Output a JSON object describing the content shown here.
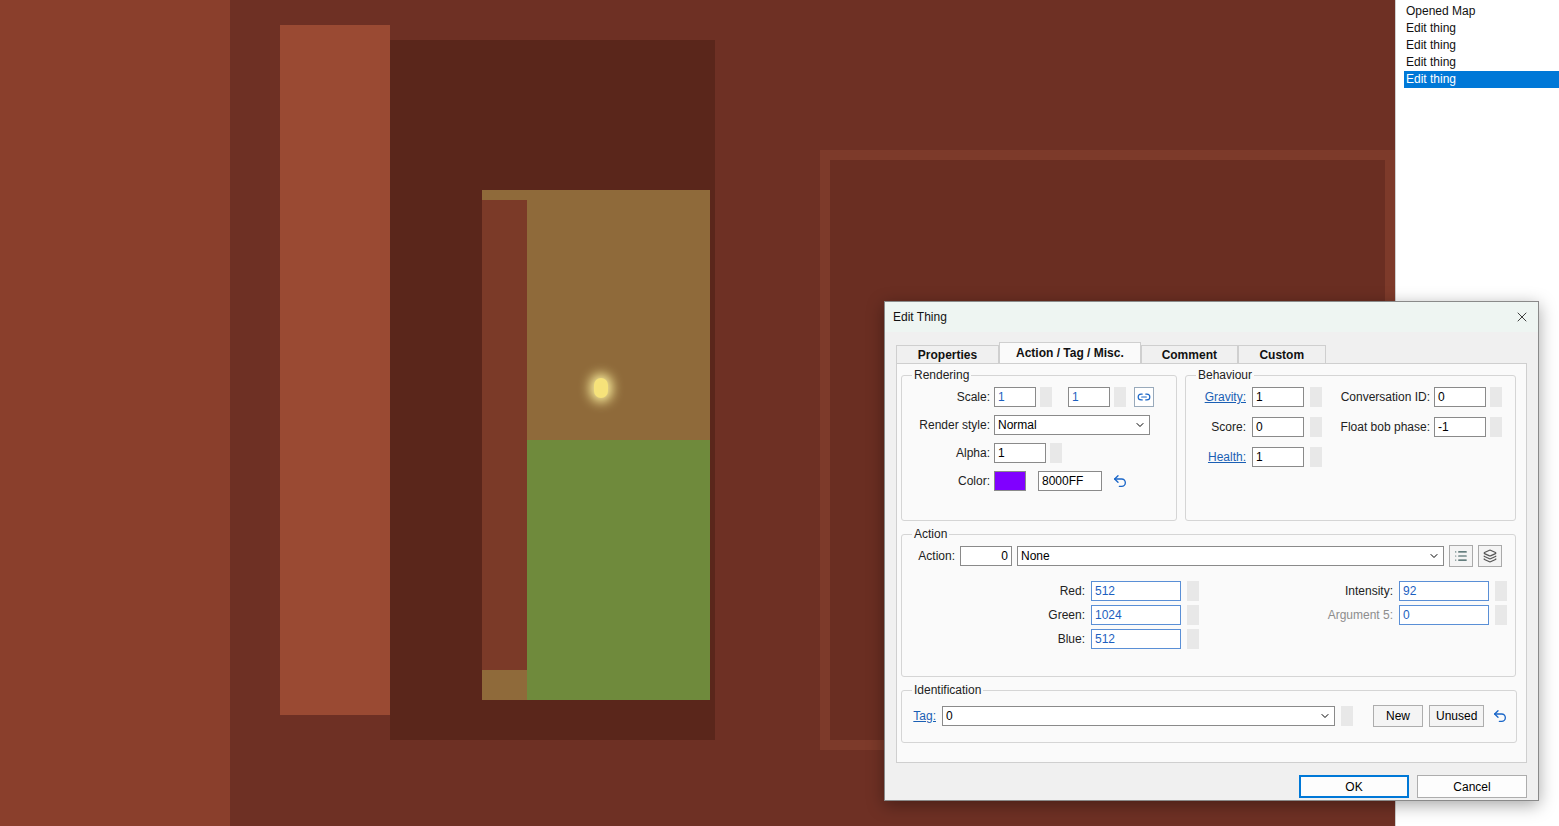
{
  "history": [
    {
      "label": "Opened Map",
      "selected": false
    },
    {
      "label": "Edit thing",
      "selected": false
    },
    {
      "label": "Edit thing",
      "selected": false
    },
    {
      "label": "Edit thing",
      "selected": false
    },
    {
      "label": "Edit thing",
      "selected": true
    }
  ],
  "dialog": {
    "title": "Edit Thing",
    "tabs": [
      {
        "label": "Properties",
        "selected": false
      },
      {
        "label": "Action / Tag / Misc.",
        "selected": true
      },
      {
        "label": "Comment",
        "selected": false
      },
      {
        "label": "Custom",
        "selected": false
      }
    ],
    "rendering": {
      "title": "Rendering",
      "scale": {
        "label": "Scale:",
        "x": "1",
        "y": "1"
      },
      "render_style": {
        "label": "Render style:",
        "value": "Normal"
      },
      "alpha": {
        "label": "Alpha:",
        "value": "1"
      },
      "color": {
        "label": "Color:",
        "value": "8000FF",
        "swatch": "#8000FF"
      }
    },
    "behaviour": {
      "title": "Behaviour",
      "fields": [
        {
          "label": "Gravity:",
          "value": "1",
          "link": true
        },
        {
          "label": "Score:",
          "value": "0",
          "link": false
        },
        {
          "label": "Health:",
          "value": "1",
          "link": true
        }
      ],
      "fields_right": [
        {
          "label": "Conversation ID:",
          "value": "0"
        },
        {
          "label": "Float bob phase:",
          "value": "-1"
        }
      ]
    },
    "action": {
      "title": "Action",
      "label": "Action:",
      "number": "0",
      "name": "None",
      "args_left": [
        {
          "label": "Red:",
          "value": "512",
          "disabled": false
        },
        {
          "label": "Green:",
          "value": "1024",
          "disabled": false
        },
        {
          "label": "Blue:",
          "value": "512",
          "disabled": false
        }
      ],
      "args_right": [
        {
          "label": "Intensity:",
          "value": "92",
          "disabled": false
        },
        {
          "label": "Argument 5:",
          "value": "0",
          "disabled": true
        }
      ]
    },
    "identification": {
      "title": "Identification",
      "tag_label": "Tag:",
      "tag_value": "0",
      "buttons": [
        "New",
        "Unused"
      ]
    },
    "buttons": [
      {
        "label": "OK",
        "default": true
      },
      {
        "label": "Cancel",
        "default": false
      }
    ]
  }
}
